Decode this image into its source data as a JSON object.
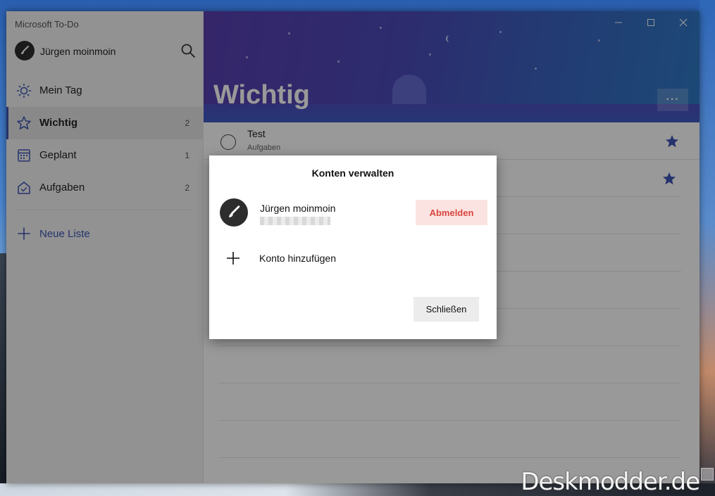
{
  "app": {
    "title": "Microsoft To-Do"
  },
  "user": {
    "name": "Jürgen moinmoin"
  },
  "sidebar": {
    "items": [
      {
        "label": "Mein Tag",
        "count": "",
        "icon": "sun-icon"
      },
      {
        "label": "Wichtig",
        "count": "2",
        "icon": "star-icon"
      },
      {
        "label": "Geplant",
        "count": "1",
        "icon": "calendar-icon"
      },
      {
        "label": "Aufgaben",
        "count": "2",
        "icon": "home-check-icon"
      }
    ],
    "new_list_label": "Neue Liste"
  },
  "main": {
    "list_title": "Wichtig",
    "more_label": "···",
    "tasks": [
      {
        "title": "Test",
        "subtitle": "Aufgaben",
        "starred": true
      }
    ]
  },
  "dialog": {
    "title": "Konten verwalten",
    "account_name": "Jürgen moinmoin",
    "logout_label": "Abmelden",
    "add_account_label": "Konto hinzufügen",
    "close_label": "Schließen"
  },
  "watermark": "Deskmodder.de",
  "colors": {
    "accent": "#3e55b5",
    "logout_bg": "#fbe3e1",
    "logout_text": "#d9463e",
    "star": "#3e55b5"
  }
}
